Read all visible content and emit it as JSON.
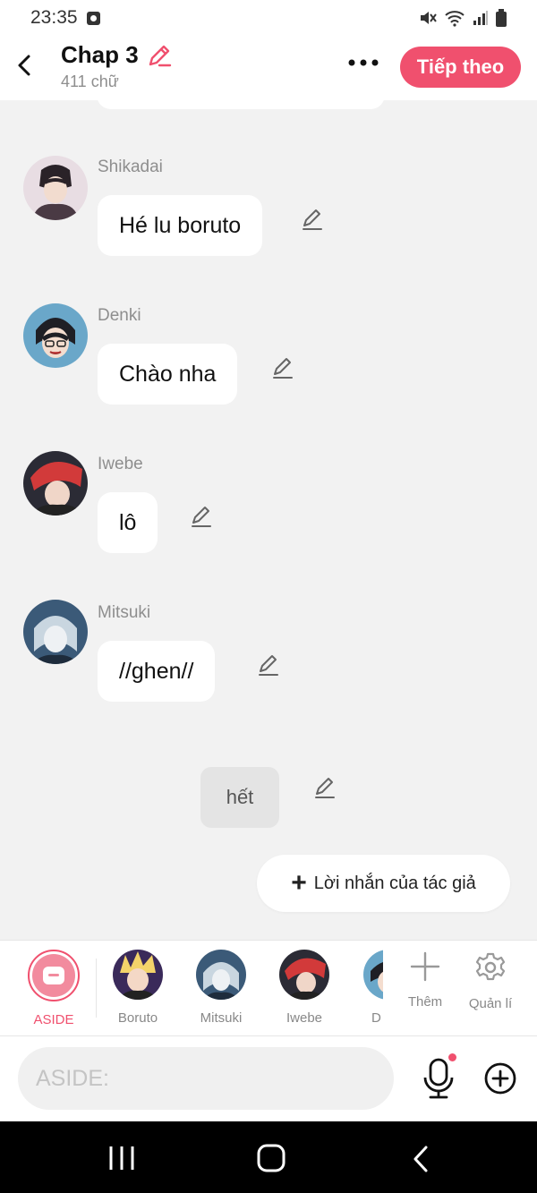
{
  "status_bar": {
    "time": "23:35"
  },
  "header": {
    "title": "Chap 3",
    "subtitle": "411 chữ",
    "next_label": "Tiếp theo"
  },
  "messages": [
    {
      "sender": "Shikadai",
      "text": "Hé lu boruto"
    },
    {
      "sender": "Denki",
      "text": "Chào nha"
    },
    {
      "sender": "Iwebe",
      "text": "lô"
    },
    {
      "sender": "Mitsuki",
      "text": "//ghen//"
    }
  ],
  "narration": "hết",
  "author_note_label": "Lời nhắn của tác giả",
  "character_bar": {
    "aside_label": "ASIDE",
    "characters": [
      "Boruto",
      "Mitsuki",
      "Iwebe",
      "D"
    ],
    "add_label": "Thêm",
    "manage_label": "Quản lí"
  },
  "input": {
    "placeholder": "ASIDE:"
  },
  "colors": {
    "accent": "#f0506e",
    "background": "#f2f2f2",
    "bubble": "#ffffff"
  }
}
